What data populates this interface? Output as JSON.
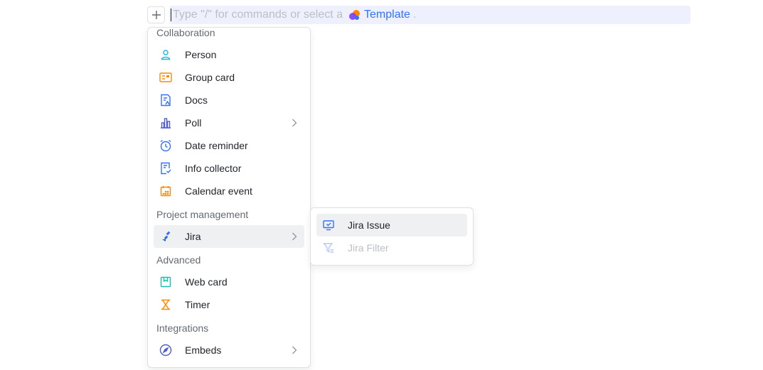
{
  "editor": {
    "placeholder_prefix": "Type \"/\" for commands or select a",
    "template_link": "Template",
    "placeholder_suffix": "."
  },
  "colors": {
    "accent_blue": "#3370ff",
    "orange": "#ff8800",
    "teal": "#14c0b2",
    "cyan": "#19b9e3",
    "indigo": "#4e5bd6"
  },
  "menu": {
    "sections": [
      {
        "title": "Collaboration"
      },
      {
        "title": "Project management"
      },
      {
        "title": "Advanced"
      },
      {
        "title": "Integrations"
      }
    ],
    "items": [
      {
        "label": "Person",
        "icon": "person-icon"
      },
      {
        "label": "Group card",
        "icon": "group-card-icon"
      },
      {
        "label": "Docs",
        "icon": "docs-icon"
      },
      {
        "label": "Poll",
        "icon": "poll-icon",
        "has_submenu": true
      },
      {
        "label": "Date reminder",
        "icon": "alarm-clock-icon"
      },
      {
        "label": "Info collector",
        "icon": "form-check-icon"
      },
      {
        "label": "Calendar event",
        "icon": "calendar-icon"
      },
      {
        "label": "Jira",
        "icon": "jira-icon",
        "has_submenu": true,
        "active": true
      },
      {
        "label": "Web card",
        "icon": "web-card-icon"
      },
      {
        "label": "Timer",
        "icon": "hourglass-icon"
      },
      {
        "label": "Embeds",
        "icon": "compass-icon",
        "has_submenu": true
      }
    ]
  },
  "submenu": {
    "items": [
      {
        "label": "Jira Issue",
        "icon": "monitor-check-icon",
        "active": true
      },
      {
        "label": "Jira Filter",
        "icon": "filter-icon",
        "disabled": true
      }
    ]
  }
}
